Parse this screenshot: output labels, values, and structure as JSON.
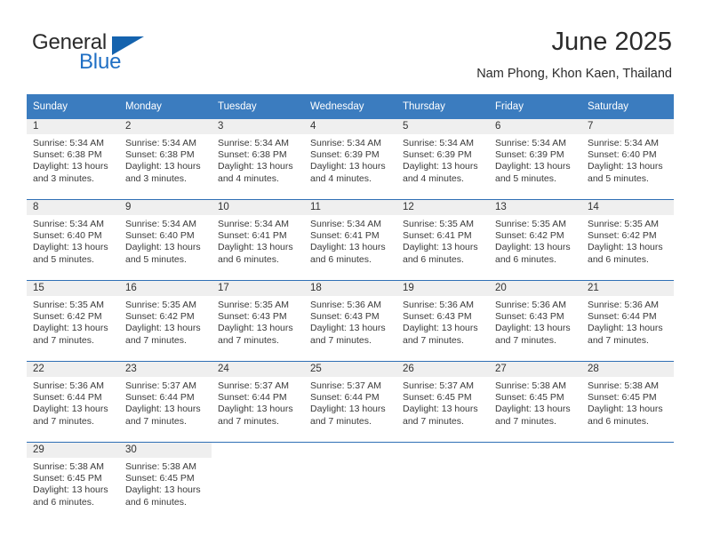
{
  "brand": {
    "word_one": "General",
    "word_two": "Blue",
    "triangle_icon": "triangle-icon",
    "accent_color": "#1563ae"
  },
  "header": {
    "title": "June 2025",
    "subtitle": "Nam Phong, Khon Kaen, Thailand"
  },
  "theme": {
    "header_blue": "#3b7cbf",
    "row_divider_blue": "#2f6fb5",
    "daynum_band": "#efefef",
    "text": "#3a3a3a"
  },
  "calendar": {
    "weekday_headers": [
      "Sunday",
      "Monday",
      "Tuesday",
      "Wednesday",
      "Thursday",
      "Friday",
      "Saturday"
    ],
    "weeks": [
      [
        {
          "day": "1",
          "sunrise": "Sunrise: 5:34 AM",
          "sunset": "Sunset: 6:38 PM",
          "daylight_line1": "Daylight: 13 hours",
          "daylight_line2": "and 3 minutes."
        },
        {
          "day": "2",
          "sunrise": "Sunrise: 5:34 AM",
          "sunset": "Sunset: 6:38 PM",
          "daylight_line1": "Daylight: 13 hours",
          "daylight_line2": "and 3 minutes."
        },
        {
          "day": "3",
          "sunrise": "Sunrise: 5:34 AM",
          "sunset": "Sunset: 6:38 PM",
          "daylight_line1": "Daylight: 13 hours",
          "daylight_line2": "and 4 minutes."
        },
        {
          "day": "4",
          "sunrise": "Sunrise: 5:34 AM",
          "sunset": "Sunset: 6:39 PM",
          "daylight_line1": "Daylight: 13 hours",
          "daylight_line2": "and 4 minutes."
        },
        {
          "day": "5",
          "sunrise": "Sunrise: 5:34 AM",
          "sunset": "Sunset: 6:39 PM",
          "daylight_line1": "Daylight: 13 hours",
          "daylight_line2": "and 4 minutes."
        },
        {
          "day": "6",
          "sunrise": "Sunrise: 5:34 AM",
          "sunset": "Sunset: 6:39 PM",
          "daylight_line1": "Daylight: 13 hours",
          "daylight_line2": "and 5 minutes."
        },
        {
          "day": "7",
          "sunrise": "Sunrise: 5:34 AM",
          "sunset": "Sunset: 6:40 PM",
          "daylight_line1": "Daylight: 13 hours",
          "daylight_line2": "and 5 minutes."
        }
      ],
      [
        {
          "day": "8",
          "sunrise": "Sunrise: 5:34 AM",
          "sunset": "Sunset: 6:40 PM",
          "daylight_line1": "Daylight: 13 hours",
          "daylight_line2": "and 5 minutes."
        },
        {
          "day": "9",
          "sunrise": "Sunrise: 5:34 AM",
          "sunset": "Sunset: 6:40 PM",
          "daylight_line1": "Daylight: 13 hours",
          "daylight_line2": "and 5 minutes."
        },
        {
          "day": "10",
          "sunrise": "Sunrise: 5:34 AM",
          "sunset": "Sunset: 6:41 PM",
          "daylight_line1": "Daylight: 13 hours",
          "daylight_line2": "and 6 minutes."
        },
        {
          "day": "11",
          "sunrise": "Sunrise: 5:34 AM",
          "sunset": "Sunset: 6:41 PM",
          "daylight_line1": "Daylight: 13 hours",
          "daylight_line2": "and 6 minutes."
        },
        {
          "day": "12",
          "sunrise": "Sunrise: 5:35 AM",
          "sunset": "Sunset: 6:41 PM",
          "daylight_line1": "Daylight: 13 hours",
          "daylight_line2": "and 6 minutes."
        },
        {
          "day": "13",
          "sunrise": "Sunrise: 5:35 AM",
          "sunset": "Sunset: 6:42 PM",
          "daylight_line1": "Daylight: 13 hours",
          "daylight_line2": "and 6 minutes."
        },
        {
          "day": "14",
          "sunrise": "Sunrise: 5:35 AM",
          "sunset": "Sunset: 6:42 PM",
          "daylight_line1": "Daylight: 13 hours",
          "daylight_line2": "and 6 minutes."
        }
      ],
      [
        {
          "day": "15",
          "sunrise": "Sunrise: 5:35 AM",
          "sunset": "Sunset: 6:42 PM",
          "daylight_line1": "Daylight: 13 hours",
          "daylight_line2": "and 7 minutes."
        },
        {
          "day": "16",
          "sunrise": "Sunrise: 5:35 AM",
          "sunset": "Sunset: 6:42 PM",
          "daylight_line1": "Daylight: 13 hours",
          "daylight_line2": "and 7 minutes."
        },
        {
          "day": "17",
          "sunrise": "Sunrise: 5:35 AM",
          "sunset": "Sunset: 6:43 PM",
          "daylight_line1": "Daylight: 13 hours",
          "daylight_line2": "and 7 minutes."
        },
        {
          "day": "18",
          "sunrise": "Sunrise: 5:36 AM",
          "sunset": "Sunset: 6:43 PM",
          "daylight_line1": "Daylight: 13 hours",
          "daylight_line2": "and 7 minutes."
        },
        {
          "day": "19",
          "sunrise": "Sunrise: 5:36 AM",
          "sunset": "Sunset: 6:43 PM",
          "daylight_line1": "Daylight: 13 hours",
          "daylight_line2": "and 7 minutes."
        },
        {
          "day": "20",
          "sunrise": "Sunrise: 5:36 AM",
          "sunset": "Sunset: 6:43 PM",
          "daylight_line1": "Daylight: 13 hours",
          "daylight_line2": "and 7 minutes."
        },
        {
          "day": "21",
          "sunrise": "Sunrise: 5:36 AM",
          "sunset": "Sunset: 6:44 PM",
          "daylight_line1": "Daylight: 13 hours",
          "daylight_line2": "and 7 minutes."
        }
      ],
      [
        {
          "day": "22",
          "sunrise": "Sunrise: 5:36 AM",
          "sunset": "Sunset: 6:44 PM",
          "daylight_line1": "Daylight: 13 hours",
          "daylight_line2": "and 7 minutes."
        },
        {
          "day": "23",
          "sunrise": "Sunrise: 5:37 AM",
          "sunset": "Sunset: 6:44 PM",
          "daylight_line1": "Daylight: 13 hours",
          "daylight_line2": "and 7 minutes."
        },
        {
          "day": "24",
          "sunrise": "Sunrise: 5:37 AM",
          "sunset": "Sunset: 6:44 PM",
          "daylight_line1": "Daylight: 13 hours",
          "daylight_line2": "and 7 minutes."
        },
        {
          "day": "25",
          "sunrise": "Sunrise: 5:37 AM",
          "sunset": "Sunset: 6:44 PM",
          "daylight_line1": "Daylight: 13 hours",
          "daylight_line2": "and 7 minutes."
        },
        {
          "day": "26",
          "sunrise": "Sunrise: 5:37 AM",
          "sunset": "Sunset: 6:45 PM",
          "daylight_line1": "Daylight: 13 hours",
          "daylight_line2": "and 7 minutes."
        },
        {
          "day": "27",
          "sunrise": "Sunrise: 5:38 AM",
          "sunset": "Sunset: 6:45 PM",
          "daylight_line1": "Daylight: 13 hours",
          "daylight_line2": "and 7 minutes."
        },
        {
          "day": "28",
          "sunrise": "Sunrise: 5:38 AM",
          "sunset": "Sunset: 6:45 PM",
          "daylight_line1": "Daylight: 13 hours",
          "daylight_line2": "and 6 minutes."
        }
      ],
      [
        {
          "day": "29",
          "sunrise": "Sunrise: 5:38 AM",
          "sunset": "Sunset: 6:45 PM",
          "daylight_line1": "Daylight: 13 hours",
          "daylight_line2": "and 6 minutes."
        },
        {
          "day": "30",
          "sunrise": "Sunrise: 5:38 AM",
          "sunset": "Sunset: 6:45 PM",
          "daylight_line1": "Daylight: 13 hours",
          "daylight_line2": "and 6 minutes."
        },
        {
          "day": "",
          "sunrise": "",
          "sunset": "",
          "daylight_line1": "",
          "daylight_line2": "",
          "empty": true
        },
        {
          "day": "",
          "sunrise": "",
          "sunset": "",
          "daylight_line1": "",
          "daylight_line2": "",
          "empty": true
        },
        {
          "day": "",
          "sunrise": "",
          "sunset": "",
          "daylight_line1": "",
          "daylight_line2": "",
          "empty": true
        },
        {
          "day": "",
          "sunrise": "",
          "sunset": "",
          "daylight_line1": "",
          "daylight_line2": "",
          "empty": true
        },
        {
          "day": "",
          "sunrise": "",
          "sunset": "",
          "daylight_line1": "",
          "daylight_line2": "",
          "empty": true
        }
      ]
    ]
  }
}
